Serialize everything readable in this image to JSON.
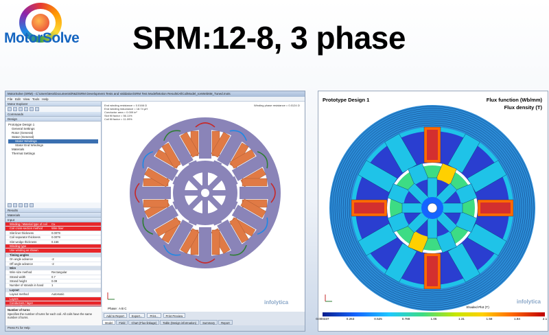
{
  "slide": {
    "logo_text": "MotorSolve",
    "title": "SRM:12-8, 3 phase"
  },
  "app": {
    "window_title": "MotorSolve (SRM) - C:\\Users\\tess\\Documents\\R&D\\SRM Development Tests and Validation\\SRM Test Model\\Motion Results\\AllCoilModel_IonWeb6M_Tuned.mots",
    "menu": [
      "File",
      "Edit",
      "View",
      "Tools",
      "Help"
    ],
    "explorer_header": "Motor Explorer",
    "commands_header": "Commands",
    "design_header": "Design",
    "tree": [
      {
        "label": "Prototype Design 1",
        "level": 0
      },
      {
        "label": "General Settings",
        "level": 1
      },
      {
        "label": "Rotor (General)",
        "level": 1
      },
      {
        "label": "Stator (General)",
        "level": 1
      },
      {
        "label": "Stator Windings",
        "level": 2,
        "selected": true
      },
      {
        "label": "Stator End Windings",
        "level": 2
      },
      {
        "label": "Materials",
        "level": 1
      },
      {
        "label": "Thermal Settings",
        "level": 1
      }
    ],
    "results_header": "Results",
    "materials_header": "Materials",
    "input_header": "Input",
    "grid": [
      {
        "k": "Winding / Material type of coil",
        "v": "Cu",
        "style": "red"
      },
      {
        "k": "Coil cross-section method",
        "v": "Wire liner",
        "style": "red"
      },
      {
        "k": "Slot liner thickness",
        "v": "0.0079",
        "style": ""
      },
      {
        "k": "Coil separator thickness",
        "v": "0.0079",
        "style": ""
      },
      {
        "k": "Slot wedge thickness",
        "v": "0.156",
        "style": ""
      },
      {
        "k": "Winding type",
        "v": "",
        "style": "red"
      },
      {
        "k": "Use winding as shown",
        "v": "",
        "style": "red"
      },
      {
        "k": "Timing angles",
        "v": "",
        "style": "cat"
      },
      {
        "k": "On angle advance",
        "v": "-2",
        "style": ""
      },
      {
        "k": "Off angle advance",
        "v": "-2",
        "style": ""
      },
      {
        "k": "Wire",
        "v": "",
        "style": "cat"
      },
      {
        "k": "Wire size method",
        "v": "Rectangular",
        "style": ""
      },
      {
        "k": "Strand width",
        "v": "0.7",
        "style": ""
      },
      {
        "k": "Strand height",
        "v": "0.09",
        "style": ""
      },
      {
        "k": "Number of strands in hand",
        "v": "1",
        "style": ""
      },
      {
        "k": "Layout",
        "v": "",
        "style": "cat"
      },
      {
        "k": "Layout method",
        "v": "Automatic",
        "style": ""
      },
      {
        "k": "Layers",
        "v": "",
        "style": "red"
      },
      {
        "k": "Conductors / layer",
        "v": "",
        "style": "red"
      },
      {
        "k": "Phase offset",
        "v": "",
        "style": "red"
      },
      {
        "k": "Insulation factor",
        "v": "",
        "style": "red"
      },
      {
        "k": "Number of turns",
        "v": "76",
        "style": "red"
      }
    ],
    "desc_title": "Number of turns",
    "desc_text": "Specifies the number of turns for each coil. All coils have the same number of turns.",
    "results_left": [
      "End winding resistance = 0.0166 Ω",
      "End winding inductance = 18.74 µH",
      "",
      "Conductor area = 0.009 in²",
      "Slot fill factor = 56.11%",
      "Coil fill factor = 11.09%"
    ],
    "results_right": "Winding phase resistance = 0.0124 Ω",
    "phase_label": "Phase:",
    "phases": "A  B  C",
    "view_buttons": [
      "Add to Report",
      "Export...",
      "Print...",
      "Print Preview"
    ],
    "tabs": [
      "Model",
      "Field",
      "Chart (Flux-linkage)",
      "Table (Design information)",
      "Summary",
      "Report"
    ],
    "status": "Press F1 for Help",
    "brand_small": "infolytica"
  },
  "plot": {
    "title": "Prototype Design 1",
    "right_label_1": "Flux function (Wb/mm)",
    "right_label_2": "Flux density (T)",
    "colorbar_label": "Shaded Plot (T)",
    "colorbar_ticks": [
      "0.000337",
      "0.263",
      "0.525",
      "0.788",
      "1.05",
      "1.31",
      "1.58",
      "1.84",
      "2.1"
    ],
    "brand": "infolytica",
    "colors": {
      "low": "#0a1e8c",
      "mid": "#3ddc84",
      "high": "#c00000"
    }
  },
  "colors": {
    "rotor_stator": "#8a84b8",
    "coil": "#e07a45",
    "accent_red": "#e8262a",
    "title_blue": "#1565c0"
  }
}
